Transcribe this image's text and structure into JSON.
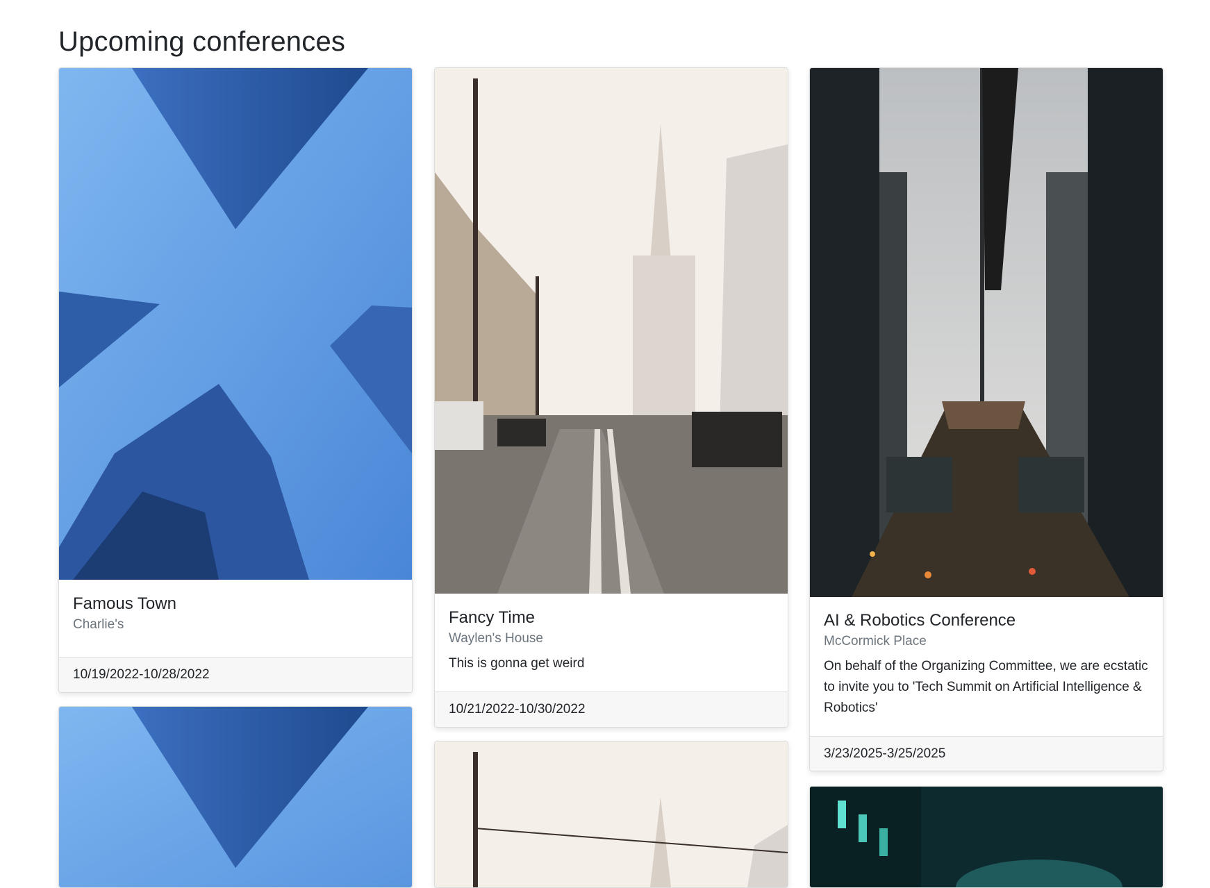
{
  "page": {
    "title": "Upcoming conferences"
  },
  "cards": [
    {
      "name": "Famous Town",
      "location": "Charlie's",
      "description": "",
      "dates": "10/19/2022-10/28/2022",
      "image": "skyscrapers-from-below-photo"
    },
    {
      "name": "Fancy Time",
      "location": "Waylen's House",
      "description": "This is gonna get weird",
      "dates": "10/21/2022-10/30/2022",
      "image": "city-street-cable-car-photo"
    },
    {
      "name": "AI & Robotics Conference",
      "location": "McCormick Place",
      "description": "On behalf of the Organizing Committee, we are ecstatic to invite you to 'Tech Summit on Artificial Intelligence & Robotics'",
      "dates": "3/23/2025-3/25/2025",
      "image": "elevated-train-city-photo"
    },
    {
      "image": "skyscrapers-from-below-photo"
    },
    {
      "image": "city-street-cable-car-photo"
    },
    {
      "image": "dark-city-night-photo"
    }
  ],
  "colors": {
    "sky": "#6aa6ec",
    "building_blue": "#2f5fae",
    "street_light": "#f4efe8",
    "dark_teal": "#0d2a2e",
    "muted_text": "#6c757d",
    "footer_bg": "#f7f7f7"
  }
}
